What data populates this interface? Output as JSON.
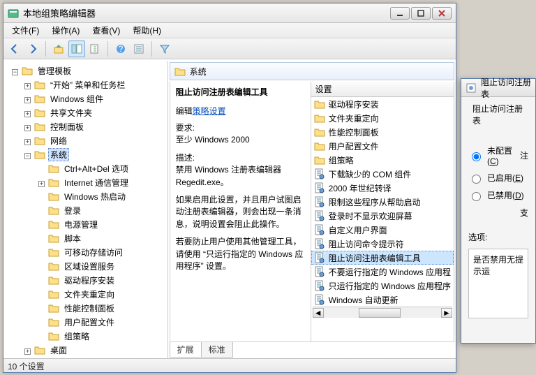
{
  "window": {
    "title": "本地组策略编辑器"
  },
  "menu": {
    "file": "文件(F)",
    "action": "操作(A)",
    "view": "查看(V)",
    "help": "帮助(H)"
  },
  "tree": {
    "root": "管理模板",
    "items": [
      "“开始” 菜单和任务栏",
      "Windows 组件",
      "共享文件夹",
      "控制面板",
      "网络",
      "系统",
      "桌面"
    ],
    "system_children": [
      "Ctrl+Alt+Del 选项",
      "Internet 通信管理",
      "Windows 热启动",
      "登录",
      "电源管理",
      "脚本",
      "可移动存储访问",
      "区域设置服务",
      "驱动程序安装",
      "文件夹重定向",
      "性能控制面板",
      "用户配置文件",
      "组策略"
    ]
  },
  "right_header": "系统",
  "detail": {
    "title": "阻止访问注册表编辑工具",
    "edit_prefix": "编辑",
    "edit_link": "策略设置",
    "req_label": "要求:",
    "req_value": "至少 Windows 2000",
    "desc_label": "描述:",
    "desc1": "禁用 Windows 注册表编辑器 Regedit.exe。",
    "desc2": "如果启用此设置，并且用户试图启动注册表编辑器，则会出现一条消息，说明设置会阻止此操作。",
    "desc3": "若要防止用户使用其他管理工具，请使用 “只运行指定的 Windows 应用程序” 设置。"
  },
  "list": {
    "col": "设置",
    "rows": [
      {
        "icon": "folder",
        "text": "驱动程序安装"
      },
      {
        "icon": "folder",
        "text": "文件夹重定向"
      },
      {
        "icon": "folder",
        "text": "性能控制面板"
      },
      {
        "icon": "folder",
        "text": "用户配置文件"
      },
      {
        "icon": "folder",
        "text": "组策略"
      },
      {
        "icon": "policy",
        "text": "下载缺少的 COM 组件"
      },
      {
        "icon": "policy",
        "text": "2000 年世纪转译"
      },
      {
        "icon": "policy",
        "text": "限制这些程序从帮助启动"
      },
      {
        "icon": "policy",
        "text": "登录时不显示欢迎屏幕"
      },
      {
        "icon": "policy",
        "text": "自定义用户界面"
      },
      {
        "icon": "policy",
        "text": "阻止访问命令提示符"
      },
      {
        "icon": "policy",
        "text": "阻止访问注册表编辑工具",
        "sel": true
      },
      {
        "icon": "policy",
        "text": "不要运行指定的 Windows 应用程"
      },
      {
        "icon": "policy",
        "text": "只运行指定的 Windows 应用程序"
      },
      {
        "icon": "policy",
        "text": "Windows 自动更新"
      }
    ]
  },
  "tabs": {
    "extended": "扩展",
    "standard": "标准"
  },
  "status": "10 个设置",
  "dialog": {
    "title": "阻止访问注册表",
    "heading": "阻止访问注册表",
    "note_right": "注",
    "opt_not_configured": "未配置(C)",
    "opt_enabled": "已启用(E)",
    "opt_disabled": "已禁用(D)",
    "support_right": "支",
    "options_label": "选项:",
    "box_text": "是否禁用无提示运"
  }
}
